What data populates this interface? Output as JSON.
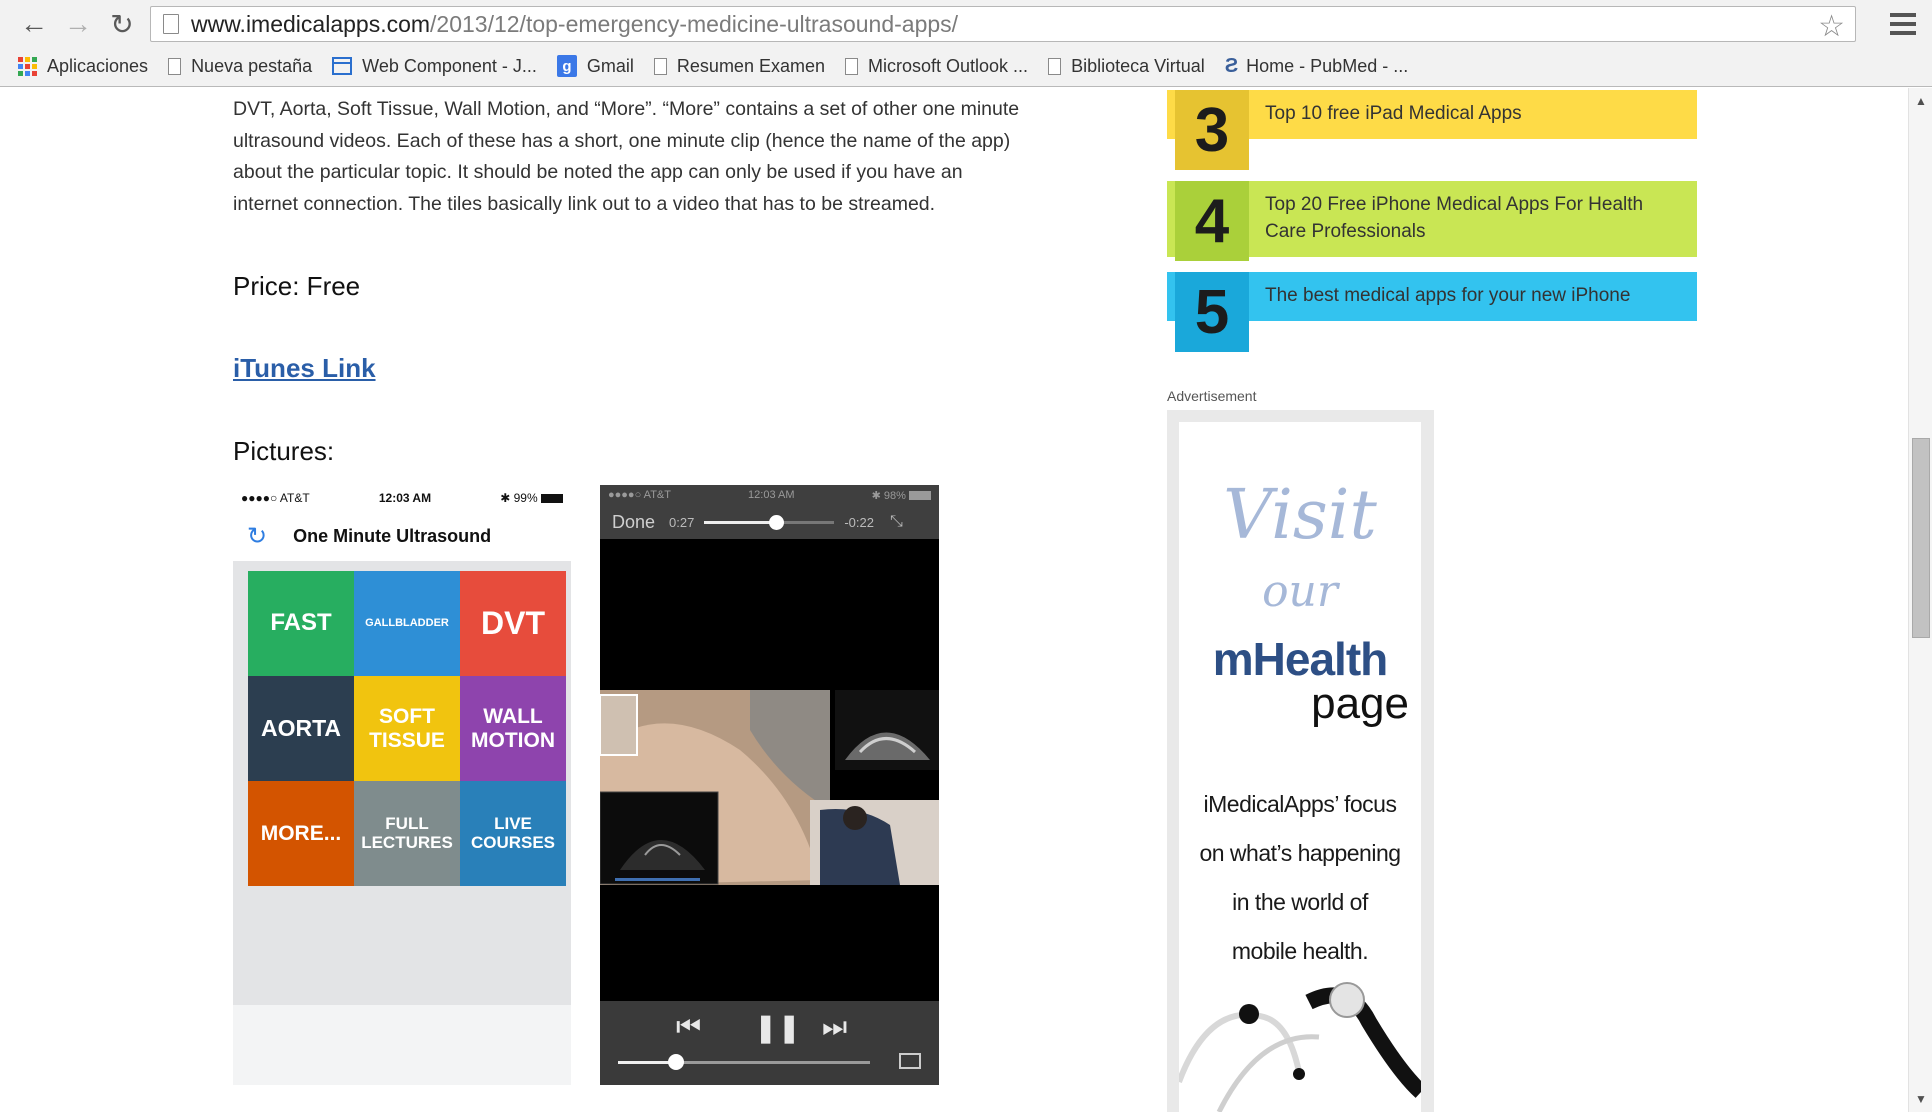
{
  "browser": {
    "url_host": "www.imedicalapps.com",
    "url_path": "/2013/12/top-emergency-medicine-ultrasound-apps/",
    "bookmarks": [
      {
        "label": "Aplicaciones",
        "icon": "apps-grid-icon"
      },
      {
        "label": "Nueva pestaña",
        "icon": "page-icon"
      },
      {
        "label": "Web Component - J...",
        "icon": "web-component-icon"
      },
      {
        "label": "Gmail",
        "icon": "google-icon"
      },
      {
        "label": "Resumen Examen",
        "icon": "page-icon"
      },
      {
        "label": "Microsoft Outlook ...",
        "icon": "page-icon"
      },
      {
        "label": "Biblioteca Virtual",
        "icon": "page-icon"
      },
      {
        "label": "Home - PubMed - ...",
        "icon": "pubmed-icon"
      }
    ]
  },
  "article": {
    "paragraph_lines": [
      "DVT, Aorta, Soft Tissue, Wall Motion, and “More”. “More” contains a set of other one minute",
      "ultrasound videos. Each of these has a short, one minute clip (hence the name of the app)",
      "about the particular topic. It should be noted the app can only be used if you have an",
      "internet connection. The tiles basically link out to a video that has to be streamed."
    ],
    "price": "Price: Free",
    "itunes_link": "iTunes Link ",
    "pictures_heading": "Pictures:"
  },
  "phone1": {
    "carrier": "●●●●○ AT&T",
    "time": "12:03 AM",
    "battery": "99%",
    "app_title": "One Minute Ultrasound",
    "tiles": [
      {
        "label": "FAST",
        "color": "#27ae60"
      },
      {
        "label": "GALLBLADDER",
        "color": "#2e8fd6"
      },
      {
        "label": "DVT",
        "color": "#e74c3c"
      },
      {
        "label": "AORTA",
        "color": "#2c3e50"
      },
      {
        "label": "SOFT TISSUE",
        "color": "#f1c40f"
      },
      {
        "label": "WALL MOTION",
        "color": "#8e44ad"
      },
      {
        "label": "MORE...",
        "color": "#d35400"
      },
      {
        "label": "FULL LECTURES",
        "color": "#7f8c8d"
      },
      {
        "label": "LIVE COURSES",
        "color": "#2980b9"
      }
    ]
  },
  "phone2": {
    "carrier": "●●●●○ AT&T",
    "time": "12:03 AM",
    "battery": "98%",
    "done_label": "Done",
    "elapsed": "0:27",
    "remaining": "-0:22",
    "progress_fraction": 0.55,
    "volume_fraction": 0.23
  },
  "sidebar": {
    "items": [
      {
        "num": "3",
        "text": "Top 10 free iPad Medical Apps",
        "bar_color": "#fedb47",
        "num_color": "#e6c331"
      },
      {
        "num": "4",
        "text": "Top 20 Free iPhone Medical Apps For Health Care Professionals",
        "bar_color": "#c9e654",
        "num_color": "#aad03a"
      },
      {
        "num": "5",
        "text": "The best medical apps for your new iPhone",
        "bar_color": "#33c3ef",
        "num_color": "#1aa8da"
      }
    ],
    "ad_label": "Advertisement",
    "ad": {
      "visit": "Visit",
      "our": "our",
      "mhealth": "mHealth",
      "page": "page",
      "copy_lines": [
        "iMedicalApps’ focus",
        "on what’s happening",
        "in the world of",
        "mobile health."
      ]
    }
  }
}
